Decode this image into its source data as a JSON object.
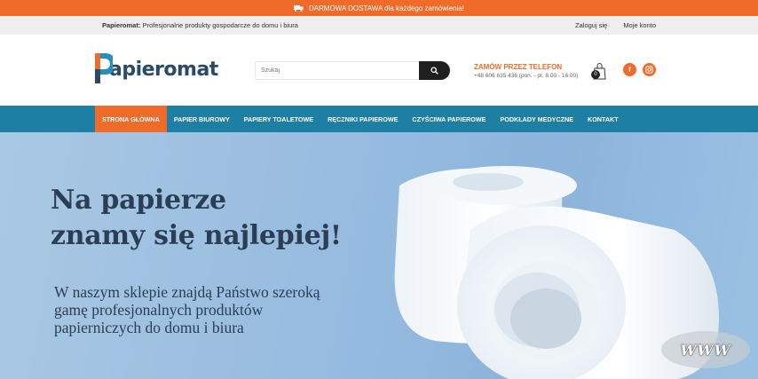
{
  "promo": {
    "text": "DARMOWA DOSTAWA dla każdego zamówienia!",
    "icon": "truck-icon"
  },
  "topbar": {
    "brand": "Papieromat:",
    "tagline": "Profesjonalne produkty gospodarcze do domu i biura",
    "login": "Zaloguj się",
    "account": "Moje konto"
  },
  "header": {
    "logo_text": "apieromat",
    "search_placeholder": "Szukaj",
    "phone_title": "ZAMÓW PRZEZ TELEFON",
    "phone_number": "+48 606 635 436 (pon. - pt. 8.00 - 16.00)",
    "cart_count": "0",
    "facebook_label": "f"
  },
  "nav": {
    "items": [
      {
        "label": "STRONA GŁÓWNA",
        "active": true
      },
      {
        "label": "PAPIER BIUROWY",
        "active": false
      },
      {
        "label": "PAPIERY TOALETOWE",
        "active": false
      },
      {
        "label": "RĘCZNIKI PAPIEROWE",
        "active": false
      },
      {
        "label": "CZYŚCIWA PAPIEROWE",
        "active": false
      },
      {
        "label": "PODKŁADY MEDYCZNE",
        "active": false
      },
      {
        "label": "KONTAKT",
        "active": false
      }
    ]
  },
  "hero": {
    "heading_line1": "Na papierze",
    "heading_line2": "znamy się najlepiej!",
    "text": "W naszym sklepie znajdą Państwo szeroką gamę profesjonalnych produktów papierniczych do domu i biura"
  },
  "watermark": "WWW",
  "colors": {
    "accent": "#f06a2a",
    "nav": "#1e7fa4",
    "logo": "#2a4a67"
  }
}
